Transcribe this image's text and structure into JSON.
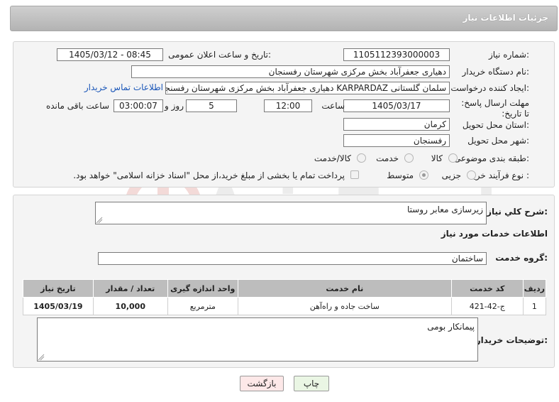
{
  "header": {
    "title": "جزئیات اطلاعات نیاز"
  },
  "form": {
    "need_number_label": "شماره نیاز:",
    "need_number": "1105112393000003",
    "announce_label": "تاریخ و ساعت اعلان عمومی:",
    "announce_value": "1405/03/12 - 08:45",
    "buyer_org_label": "نام دستگاه خریدار:",
    "buyer_org": "دهیاری جعفرآباد بخش مرکزی شهرستان رفسنجان",
    "creator_label": "ایجاد کننده درخواست:",
    "creator": "سلمان گلستانی KARPARDAZ دهیاری جعفرآباد بخش مرکزی شهرستان رفسنجان",
    "contact_link": "اطلاعات تماس خریدار",
    "deadline_label": "مهلت ارسال پاسخ: تا تاریخ:",
    "deadline_date": "1405/03/17",
    "time_label": "ساعت",
    "deadline_time": "12:00",
    "days_value": "5",
    "days_label": "روز و",
    "remaining_time": "03:00:07",
    "remaining_label": "ساعت باقی مانده",
    "province_label": "استان محل تحویل:",
    "province": "کرمان",
    "city_label": "شهر محل تحویل:",
    "city": "رفسنجان",
    "category_label": "طبقه بندی موضوعی:",
    "category_options": [
      "کالا",
      "خدمت",
      "کالا/خدمت"
    ],
    "process_label": "نوع فرآیند خرید :",
    "process_options": [
      "جزیی",
      "متوسط"
    ],
    "payment_note": "پرداخت تمام یا بخشی از مبلغ خرید،از محل \"اسناد خزانه اسلامی\" خواهد بود."
  },
  "summary": {
    "label": "شرح کلي نياز:",
    "value": "زیرسازی معابر روستا"
  },
  "services": {
    "section_title": "اطلاعات خدمات مورد نیاز",
    "group_label": "گروه خدمت:",
    "group_value": "ساختمان",
    "columns": [
      "ردیف",
      "کد خدمت",
      "نام خدمت",
      "واحد اندازه گیری",
      "تعداد / مقدار",
      "تاریخ نیاز"
    ],
    "rows": [
      [
        "1",
        "ج-42-421",
        "ساخت جاده و راه‌آهن",
        "مترمربع",
        "10,000",
        "1405/03/19"
      ]
    ]
  },
  "notes": {
    "label": "توضیحات خریدار:",
    "value": "پیمانکار بومی"
  },
  "buttons": {
    "print": "چاپ",
    "back": "بازگشت"
  },
  "watermark": "AriaTender.net",
  "colors": {
    "link": "#1a56b8",
    "back_button": "#fde8e8",
    "print_button": "#eaf6e4"
  }
}
